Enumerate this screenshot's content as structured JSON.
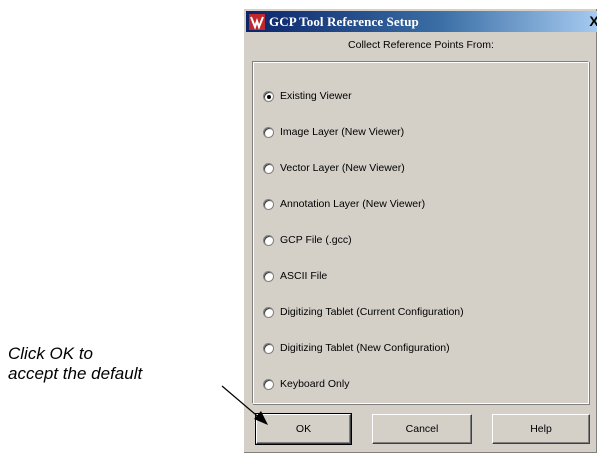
{
  "dialog": {
    "title": "GCP Tool Reference Setup",
    "close_label": "X",
    "subtitle": "Collect Reference Points From:",
    "options": [
      {
        "label": "Existing Viewer",
        "checked": true
      },
      {
        "label": "Image Layer (New Viewer)",
        "checked": false
      },
      {
        "label": "Vector Layer (New Viewer)",
        "checked": false
      },
      {
        "label": "Annotation Layer (New Viewer)",
        "checked": false
      },
      {
        "label": "GCP File (.gcc)",
        "checked": false
      },
      {
        "label": "ASCII File",
        "checked": false
      },
      {
        "label": "Digitizing Tablet (Current Configuration)",
        "checked": false
      },
      {
        "label": "Digitizing Tablet (New Configuration)",
        "checked": false
      },
      {
        "label": "Keyboard Only",
        "checked": false
      }
    ],
    "buttons": {
      "ok": "OK",
      "cancel": "Cancel",
      "help": "Help"
    }
  },
  "annotation": {
    "line1": "Click OK to",
    "line2": "accept the default"
  },
  "colors": {
    "titlebar_start": "#0a246a",
    "titlebar_end": "#a6caf0",
    "dialog_face": "#d4d0c8",
    "app_icon_accent": "#c0282d"
  }
}
